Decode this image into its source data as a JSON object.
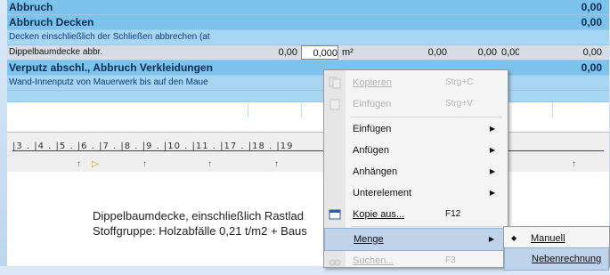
{
  "table": {
    "rows": [
      {
        "text": "Abbruch",
        "total": "0,00"
      },
      {
        "text": "Abbruch Decken",
        "total": "0,00"
      },
      {
        "text": "Decken einschließlich der Schließen abbrechen (at"
      },
      {
        "text": "Dippelbaumdecke abbr.",
        "qty": "0,00",
        "qty2": "0,000",
        "unit": "m²",
        "p1": "0,00",
        "p2": "0,00",
        "p3": "0,00",
        "total": "0,00"
      },
      {
        "text": "Verputz abschl., Abbruch Verkleidungen",
        "total": "0,00"
      },
      {
        "text": "Wand-Innenputz von Mauerwerk bis auf den Maue"
      }
    ]
  },
  "ruler": {
    "labels": "|3 . |4 . |5 . |6 . |7 . |8 . |9 . |10 . |11                                  . |17 . |18 . |19"
  },
  "document": {
    "line1": "Dippelbaumdecke, einschließlich Rastlad",
    "line2": "Stoffgruppe: Holzabfälle 0,21 t/m2 + Baus"
  },
  "context_menu": {
    "kopieren": {
      "label": "Kopieren",
      "shortcut": "Strg+C"
    },
    "einfuegen_clip": {
      "label": "Einfügen",
      "shortcut": "Strg+V"
    },
    "einfuegen": {
      "label": "Einfügen"
    },
    "anfuegen": {
      "label": "Anfügen"
    },
    "anhaengen": {
      "label": "Anhängen"
    },
    "unterelement": {
      "label": "Unterelement"
    },
    "kopie_aus": {
      "label": "Kopie aus...",
      "shortcut": "F12"
    },
    "menge": {
      "label": "Menge"
    },
    "suchen": {
      "label": "Suchen...",
      "shortcut": "F3"
    }
  },
  "submenu": {
    "manuell": {
      "label": "Manuell",
      "checked": true
    },
    "nebenrechnung": {
      "label": "Nebenrechnung"
    }
  },
  "colors": {
    "row_header": "#7cc3ec",
    "row_text": "#a7d6f3",
    "highlight": "#bfd3ea"
  }
}
